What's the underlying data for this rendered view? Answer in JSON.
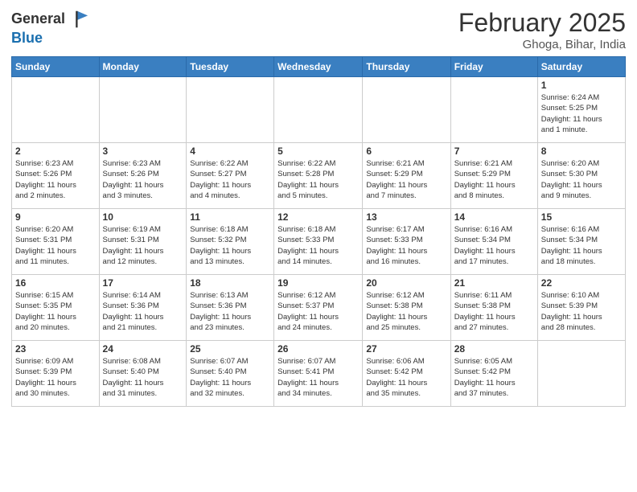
{
  "header": {
    "logo_line1": "General",
    "logo_line2": "Blue",
    "month_title": "February 2025",
    "location": "Ghoga, Bihar, India"
  },
  "days_of_week": [
    "Sunday",
    "Monday",
    "Tuesday",
    "Wednesday",
    "Thursday",
    "Friday",
    "Saturday"
  ],
  "weeks": [
    [
      {
        "day": "",
        "info": ""
      },
      {
        "day": "",
        "info": ""
      },
      {
        "day": "",
        "info": ""
      },
      {
        "day": "",
        "info": ""
      },
      {
        "day": "",
        "info": ""
      },
      {
        "day": "",
        "info": ""
      },
      {
        "day": "1",
        "info": "Sunrise: 6:24 AM\nSunset: 5:25 PM\nDaylight: 11 hours\nand 1 minute."
      }
    ],
    [
      {
        "day": "2",
        "info": "Sunrise: 6:23 AM\nSunset: 5:26 PM\nDaylight: 11 hours\nand 2 minutes."
      },
      {
        "day": "3",
        "info": "Sunrise: 6:23 AM\nSunset: 5:26 PM\nDaylight: 11 hours\nand 3 minutes."
      },
      {
        "day": "4",
        "info": "Sunrise: 6:22 AM\nSunset: 5:27 PM\nDaylight: 11 hours\nand 4 minutes."
      },
      {
        "day": "5",
        "info": "Sunrise: 6:22 AM\nSunset: 5:28 PM\nDaylight: 11 hours\nand 5 minutes."
      },
      {
        "day": "6",
        "info": "Sunrise: 6:21 AM\nSunset: 5:29 PM\nDaylight: 11 hours\nand 7 minutes."
      },
      {
        "day": "7",
        "info": "Sunrise: 6:21 AM\nSunset: 5:29 PM\nDaylight: 11 hours\nand 8 minutes."
      },
      {
        "day": "8",
        "info": "Sunrise: 6:20 AM\nSunset: 5:30 PM\nDaylight: 11 hours\nand 9 minutes."
      }
    ],
    [
      {
        "day": "9",
        "info": "Sunrise: 6:20 AM\nSunset: 5:31 PM\nDaylight: 11 hours\nand 11 minutes."
      },
      {
        "day": "10",
        "info": "Sunrise: 6:19 AM\nSunset: 5:31 PM\nDaylight: 11 hours\nand 12 minutes."
      },
      {
        "day": "11",
        "info": "Sunrise: 6:18 AM\nSunset: 5:32 PM\nDaylight: 11 hours\nand 13 minutes."
      },
      {
        "day": "12",
        "info": "Sunrise: 6:18 AM\nSunset: 5:33 PM\nDaylight: 11 hours\nand 14 minutes."
      },
      {
        "day": "13",
        "info": "Sunrise: 6:17 AM\nSunset: 5:33 PM\nDaylight: 11 hours\nand 16 minutes."
      },
      {
        "day": "14",
        "info": "Sunrise: 6:16 AM\nSunset: 5:34 PM\nDaylight: 11 hours\nand 17 minutes."
      },
      {
        "day": "15",
        "info": "Sunrise: 6:16 AM\nSunset: 5:34 PM\nDaylight: 11 hours\nand 18 minutes."
      }
    ],
    [
      {
        "day": "16",
        "info": "Sunrise: 6:15 AM\nSunset: 5:35 PM\nDaylight: 11 hours\nand 20 minutes."
      },
      {
        "day": "17",
        "info": "Sunrise: 6:14 AM\nSunset: 5:36 PM\nDaylight: 11 hours\nand 21 minutes."
      },
      {
        "day": "18",
        "info": "Sunrise: 6:13 AM\nSunset: 5:36 PM\nDaylight: 11 hours\nand 23 minutes."
      },
      {
        "day": "19",
        "info": "Sunrise: 6:12 AM\nSunset: 5:37 PM\nDaylight: 11 hours\nand 24 minutes."
      },
      {
        "day": "20",
        "info": "Sunrise: 6:12 AM\nSunset: 5:38 PM\nDaylight: 11 hours\nand 25 minutes."
      },
      {
        "day": "21",
        "info": "Sunrise: 6:11 AM\nSunset: 5:38 PM\nDaylight: 11 hours\nand 27 minutes."
      },
      {
        "day": "22",
        "info": "Sunrise: 6:10 AM\nSunset: 5:39 PM\nDaylight: 11 hours\nand 28 minutes."
      }
    ],
    [
      {
        "day": "23",
        "info": "Sunrise: 6:09 AM\nSunset: 5:39 PM\nDaylight: 11 hours\nand 30 minutes."
      },
      {
        "day": "24",
        "info": "Sunrise: 6:08 AM\nSunset: 5:40 PM\nDaylight: 11 hours\nand 31 minutes."
      },
      {
        "day": "25",
        "info": "Sunrise: 6:07 AM\nSunset: 5:40 PM\nDaylight: 11 hours\nand 32 minutes."
      },
      {
        "day": "26",
        "info": "Sunrise: 6:07 AM\nSunset: 5:41 PM\nDaylight: 11 hours\nand 34 minutes."
      },
      {
        "day": "27",
        "info": "Sunrise: 6:06 AM\nSunset: 5:42 PM\nDaylight: 11 hours\nand 35 minutes."
      },
      {
        "day": "28",
        "info": "Sunrise: 6:05 AM\nSunset: 5:42 PM\nDaylight: 11 hours\nand 37 minutes."
      },
      {
        "day": "",
        "info": ""
      }
    ]
  ]
}
